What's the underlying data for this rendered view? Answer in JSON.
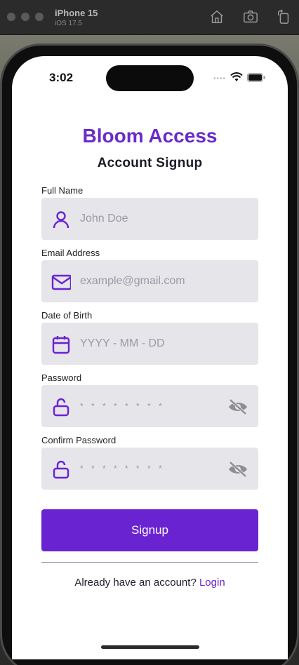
{
  "simulator": {
    "device_name": "iPhone 15",
    "os_version": "iOS 17.5"
  },
  "status_bar": {
    "time": "3:02"
  },
  "header": {
    "brand": "Bloom Access",
    "title": "Account Signup"
  },
  "form": {
    "full_name": {
      "label": "Full Name",
      "placeholder": "John Doe",
      "icon": "user-icon"
    },
    "email": {
      "label": "Email Address",
      "placeholder": "example@gmail.com",
      "icon": "mail-icon"
    },
    "dob": {
      "label": "Date of Birth",
      "placeholder": "YYYY - MM - DD",
      "icon": "calendar-icon"
    },
    "password": {
      "label": "Password",
      "placeholder": "* * * * * * * *",
      "icon": "unlock-icon",
      "toggle_icon": "eye-off-icon"
    },
    "confirm_password": {
      "label": "Confirm Password",
      "placeholder": "* * * * * * * *",
      "icon": "unlock-icon",
      "toggle_icon": "eye-off-icon"
    }
  },
  "actions": {
    "signup_label": "Signup",
    "login_prompt": "Already have an account?",
    "login_link": "Login"
  },
  "colors": {
    "accent": "#6a23d1",
    "brand_text": "#6a2bc9",
    "input_bg": "#e5e5ea",
    "icon_gray": "#8e8e93"
  }
}
